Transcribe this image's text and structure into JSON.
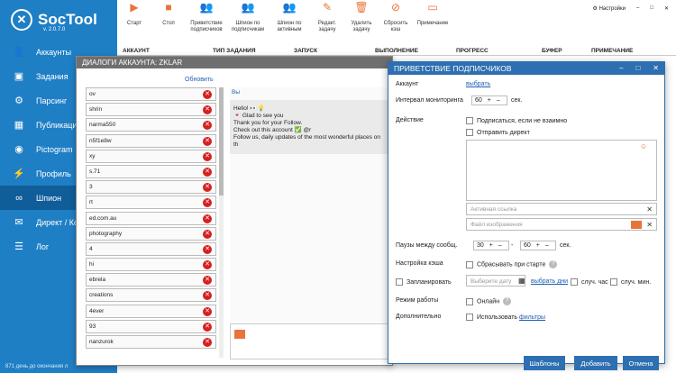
{
  "app": {
    "name": "SocTool",
    "version": "v. 2.0.7.0"
  },
  "sidebar": {
    "items": [
      {
        "label": "Аккаунты",
        "icon": "person-icon"
      },
      {
        "label": "Задания",
        "icon": "cube-icon"
      },
      {
        "label": "Парсинг",
        "icon": "parsing-icon"
      },
      {
        "label": "Публикации",
        "icon": "image-icon"
      },
      {
        "label": "Pictogram",
        "icon": "pictogram-icon"
      },
      {
        "label": "Профиль",
        "icon": "profile-icon"
      },
      {
        "label": "Шпион",
        "icon": "binoculars-icon"
      },
      {
        "label": "Директ / Ком",
        "icon": "mail-icon"
      },
      {
        "label": "Лог",
        "icon": "log-icon"
      }
    ],
    "footer": "871 день до окончания л"
  },
  "toolbar": {
    "buttons": [
      {
        "label": "Старт",
        "icon": "play-icon"
      },
      {
        "label": "Стоп",
        "icon": "stop-icon"
      },
      {
        "label": "Приветствие подписчиков",
        "icon": "welcome-icon"
      },
      {
        "label": "Шпион по подписчикам",
        "icon": "spy-followers-icon"
      },
      {
        "label": "Шпион по активным",
        "icon": "spy-active-icon"
      },
      {
        "label": "Редакт. задачу",
        "icon": "edit-icon"
      },
      {
        "label": "Удалить задачу",
        "icon": "delete-icon"
      },
      {
        "label": "Сбросить кэш",
        "icon": "reset-cache-icon"
      },
      {
        "label": "Примечание",
        "icon": "note-icon"
      }
    ],
    "settings_label": "Настройки"
  },
  "table": {
    "columns": [
      "АККАУНТ",
      "ТИП ЗАДАНИЯ",
      "ЗАПУСК",
      "ВЫПОЛНЕНИЕ",
      "ПРОГРЕСС",
      "БУФЕР",
      "ПРИМЕЧАНИЕ"
    ]
  },
  "dialog_accounts": {
    "title": "ДИАЛОГИ АККАУНТА: ZKLAR",
    "refresh": "Обновить",
    "accounts": [
      "ov",
      "shrin",
      "narma550",
      "n5f1e8w",
      "xy",
      "s.71",
      "3",
      "rt",
      "ed.com.au",
      "photography",
      "4",
      "hi",
      "ebrela",
      "creations",
      "4ever",
      "93",
      "nanzurok"
    ],
    "chat_label": "Вы",
    "message_lines": [
      "Hello! 👀💡",
      "💌 Glad to see you",
      "Thank you for your Follow.",
      "Check out this account ✅ @r",
      "Follow us, daily updates of the most wonderful places on th"
    ]
  },
  "dialog_welcome": {
    "title": "ПРИВЕТСТВИЕ ПОДПИСЧИКОВ",
    "account_label": "Аккаунт",
    "account_link": "выбрать",
    "interval_label": "Интервал мониторинга",
    "interval_value": "60",
    "interval_unit": "сек.",
    "action_label": "Действие",
    "follow_option": "Подписаться, если не взаимно",
    "direct_option": "Отправить директ",
    "active_link_placeholder": "Активная ссылка",
    "image_file_placeholder": "Файл изображения",
    "pause_label": "Паузы между сообщ.",
    "pause_from": "30",
    "pause_sep": "-",
    "pause_to": "60",
    "pause_unit": "сек.",
    "cache_label": "Настройка кэша",
    "cache_option": "Сбрасывать при старте",
    "schedule_label": "Запланировать",
    "date_placeholder": "Выберите дату",
    "choose_days_link": "выбрать дни",
    "random_hours": "случ. час",
    "random_minutes": "случ. мин.",
    "work_mode_label": "Режим работы",
    "online_option": "Онлайн",
    "extra_label": "Дополнительно",
    "use_label": "Использовать",
    "filters_link": "фильтры",
    "templates_button": "Шаблоны",
    "add_button": "Добавить",
    "cancel_button": "Отмена"
  }
}
